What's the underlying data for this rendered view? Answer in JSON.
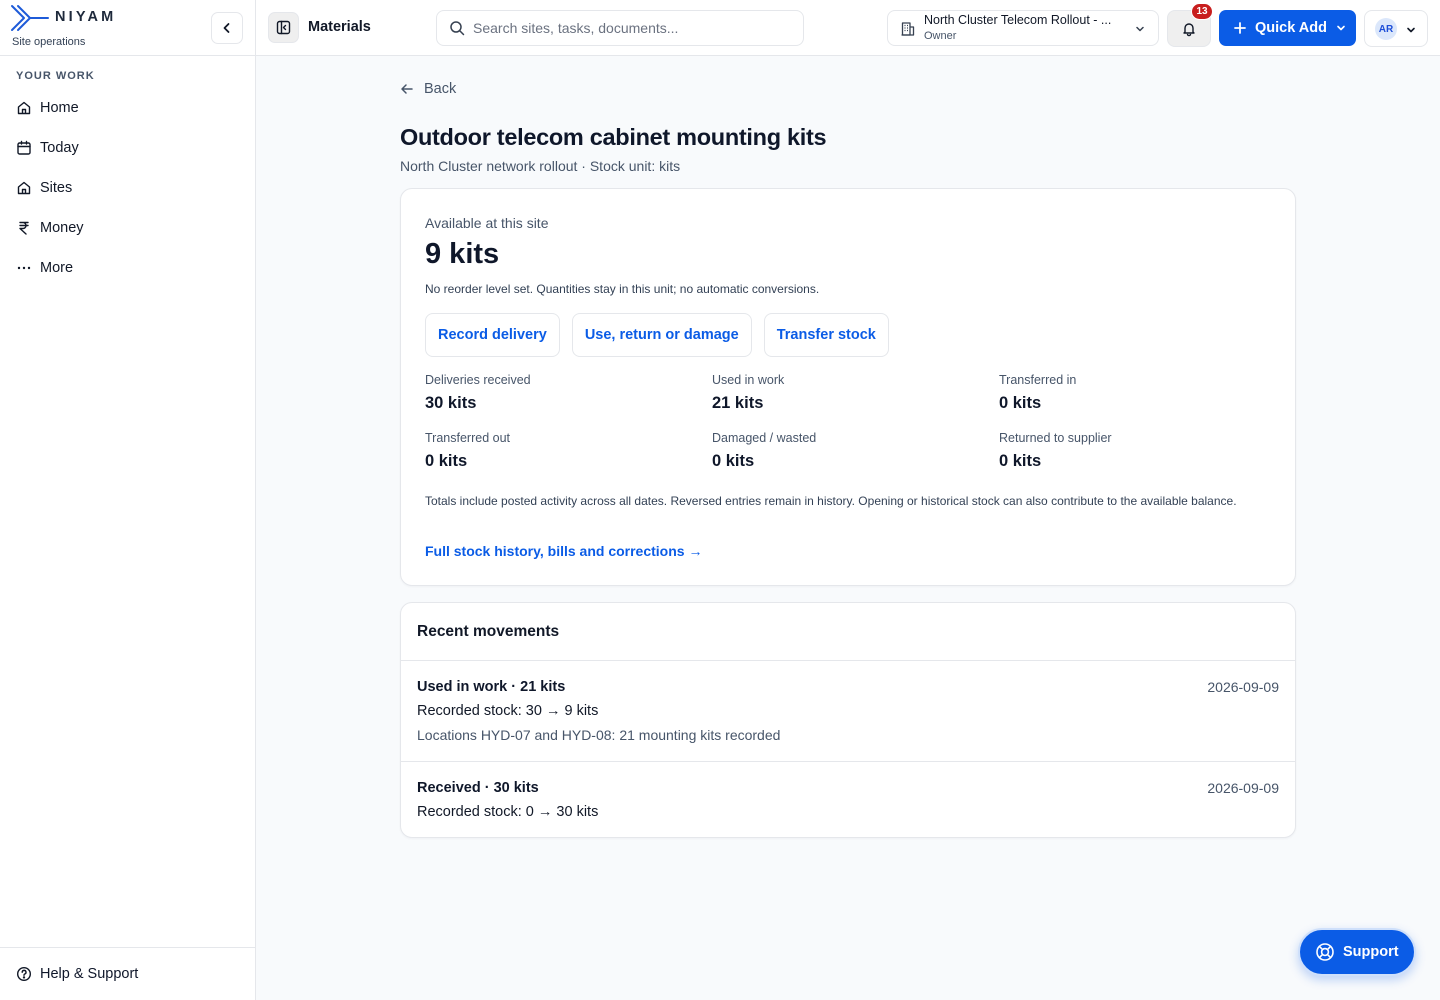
{
  "brand": {
    "name": "NIYAM",
    "tagline": "Site operations"
  },
  "sidebar": {
    "section_label": "YOUR WORK",
    "items": [
      {
        "label": "Home",
        "icon": "home-icon"
      },
      {
        "label": "Today",
        "icon": "calendar-icon"
      },
      {
        "label": "Sites",
        "icon": "building-icon"
      },
      {
        "label": "Money",
        "icon": "rupee-icon"
      },
      {
        "label": "More",
        "icon": "more-horizontal-icon"
      }
    ],
    "footer_label": "Help & Support"
  },
  "topbar": {
    "title": "Materials",
    "search_placeholder": "Search sites, tasks, documents...",
    "project_name": "North Cluster Telecom Rollout - ...",
    "project_role": "Owner",
    "notification_count": "13",
    "quick_add_label": "Quick Add",
    "user_initials": "AR"
  },
  "page": {
    "back_label": "Back",
    "title": "Outdoor telecom cabinet mounting kits",
    "subtitle": "North Cluster network rollout · Stock unit: kits"
  },
  "stock": {
    "available_label": "Available at this site",
    "available_value": "9 kits",
    "note": "No reorder level set. Quantities stay in this unit; no automatic conversions.",
    "actions": [
      "Record delivery",
      "Use, return or damage",
      "Transfer stock"
    ],
    "stats": [
      {
        "label": "Deliveries received",
        "value": "30 kits"
      },
      {
        "label": "Used in work",
        "value": "21 kits"
      },
      {
        "label": "Transferred in",
        "value": "0 kits"
      },
      {
        "label": "Transferred out",
        "value": "0 kits"
      },
      {
        "label": "Damaged / wasted",
        "value": "0 kits"
      },
      {
        "label": "Returned to supplier",
        "value": "0 kits"
      }
    ],
    "totals_note": "Totals include posted activity across all dates. Reversed entries remain in history. Opening or historical stock can also contribute to the available balance.",
    "history_link": "Full stock history, bills and corrections →"
  },
  "movements": {
    "heading": "Recent movements",
    "items": [
      {
        "title": "Used in work · 21 kits",
        "date": "2026-09-09",
        "stock_line": "Recorded stock: 30 → 9 kits",
        "note": "Locations HYD-07 and HYD-08: 21 mounting kits recorded"
      },
      {
        "title": "Received · 30 kits",
        "date": "2026-09-09",
        "stock_line": "Recorded stock: 0 → 30 kits"
      }
    ]
  },
  "support_label": "Support",
  "colors": {
    "accent": "#0b5ce6",
    "badge": "#c81e1e",
    "border": "#e5e7eb",
    "background": "#f8fafc"
  }
}
